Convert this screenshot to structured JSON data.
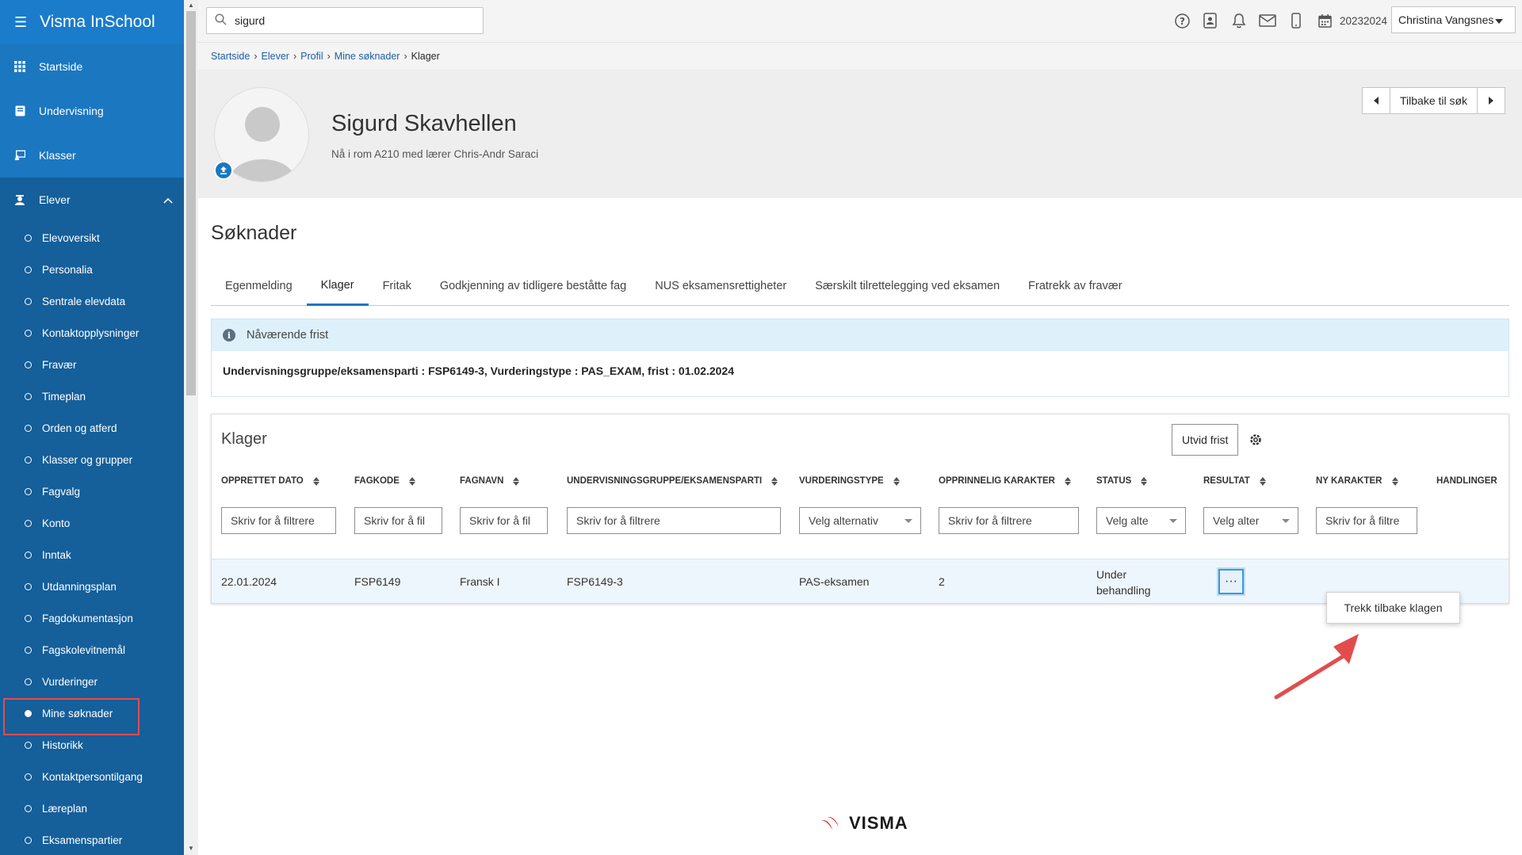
{
  "brand": {
    "title": "Visma InSchool"
  },
  "nav": {
    "top": [
      {
        "label": "Startside"
      },
      {
        "label": "Undervisning"
      },
      {
        "label": "Klasser"
      },
      {
        "label": "Elever"
      }
    ],
    "sub": [
      {
        "label": "Elevoversikt"
      },
      {
        "label": "Personalia"
      },
      {
        "label": "Sentrale elevdata"
      },
      {
        "label": "Kontaktopplysninger"
      },
      {
        "label": "Fravær"
      },
      {
        "label": "Timeplan"
      },
      {
        "label": "Orden og atferd"
      },
      {
        "label": "Klasser og grupper"
      },
      {
        "label": "Fagvalg"
      },
      {
        "label": "Konto"
      },
      {
        "label": "Inntak"
      },
      {
        "label": "Utdanningsplan"
      },
      {
        "label": "Fagdokumentasjon"
      },
      {
        "label": "Fagskolevitnemål"
      },
      {
        "label": "Vurderinger"
      },
      {
        "label": "Mine søknader",
        "active": true
      },
      {
        "label": "Historikk"
      },
      {
        "label": "Kontaktpersontilgang"
      },
      {
        "label": "Læreplan"
      },
      {
        "label": "Eksamenspartier"
      }
    ]
  },
  "topbar": {
    "search_value": "sigurd",
    "year": "20232024",
    "user": "Christina Vangsnes"
  },
  "breadcrumb": [
    "Startside",
    "Elever",
    "Profil",
    "Mine søknader",
    "Klager"
  ],
  "profile": {
    "name": "Sigurd Skavhellen",
    "location": "Nå i rom A210 med lærer Chris-Andr Saraci",
    "back_label": "Tilbake til søk"
  },
  "page": {
    "title": "Søknader",
    "tabs": [
      {
        "label": "Egenmelding"
      },
      {
        "label": "Klager",
        "active": true
      },
      {
        "label": "Fritak"
      },
      {
        "label": "Godkjenning av tidligere beståtte fag"
      },
      {
        "label": "NUS eksamensrettigheter"
      },
      {
        "label": "Særskilt tilrettelegging ved eksamen"
      },
      {
        "label": "Fratrekk av fravær"
      }
    ]
  },
  "info": {
    "header": "Nåværende frist",
    "body": "Undervisningsgruppe/eksamensparti : FSP6149-3, Vurderingstype : PAS_EXAM, frist : 01.02.2024"
  },
  "klager": {
    "title": "Klager",
    "utvid_label": "Utvid frist",
    "columns": [
      "OPPRETTET DATO",
      "FAGKODE",
      "FAGNAVN",
      "UNDERVISNINGSGRUPPE/EKSAMENSPARTI",
      "VURDERINGSTYPE",
      "OPPRINNELIG KARAKTER",
      "STATUS",
      "RESULTAT",
      "NY KARAKTER",
      "HANDLINGER"
    ],
    "filters": [
      "Skriv for å filtrere",
      "Skriv for å fil",
      "Skriv for å fil",
      "Skriv for å filtrere",
      "Velg alternativ",
      "Skriv for å filtrere",
      "Velg alte",
      "Velg alter",
      "Skriv for å filtre"
    ],
    "row": {
      "dato": "22.01.2024",
      "fagkode": "FSP6149",
      "fagnavn": "Fransk I",
      "gruppe": "FSP6149-3",
      "vurderingstype": "PAS-eksamen",
      "karakter": "2",
      "status_1": "Under",
      "status_2": "behandling",
      "actions": "···"
    },
    "popup": "Trekk tilbake klagen"
  },
  "footer": {
    "logo": "VISMA"
  },
  "colors": {
    "sidebar": "#1b77c0",
    "accent": "#1b77c0",
    "highlight": "#e34c4c"
  }
}
